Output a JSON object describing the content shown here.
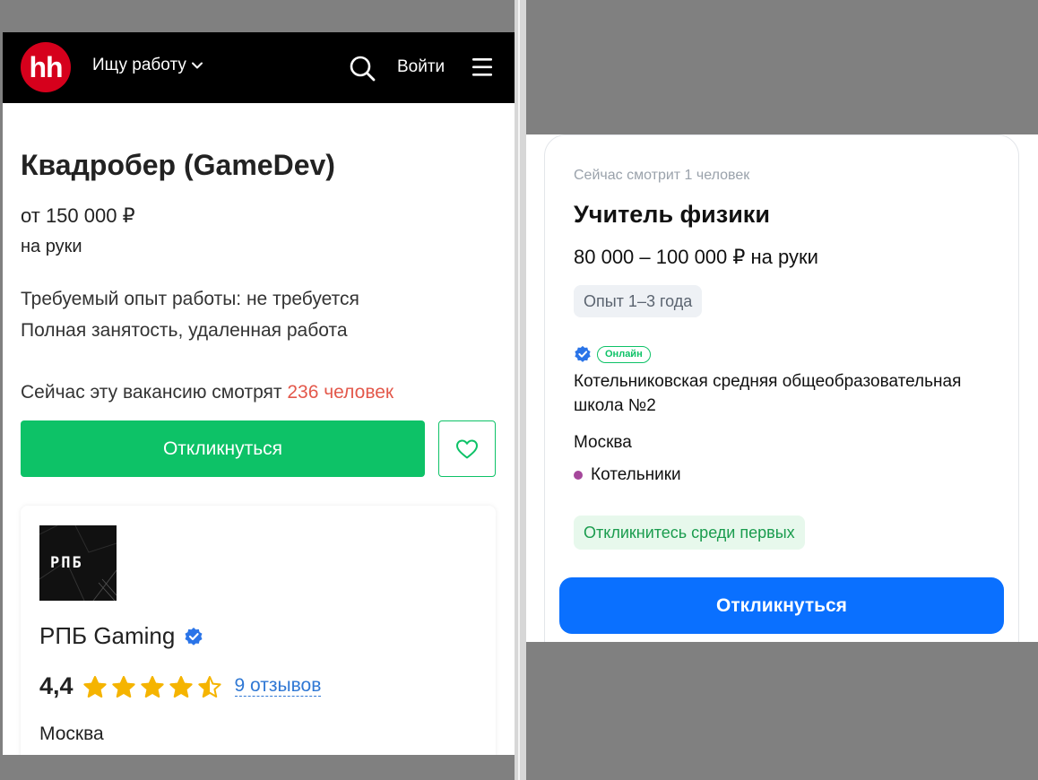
{
  "left_panel": {
    "header": {
      "logo_text": "hh",
      "mode_label": "Ищу работу",
      "login_label": "Войти"
    },
    "vacancy": {
      "title": "Квадробер (GameDev)",
      "salary": "от 150 000 ₽",
      "salary_note": "на руки",
      "experience": "Требуемый опыт работы: не требуется",
      "employment": "Полная занятость, удаленная работа",
      "watching_prefix": "Сейчас эту вакансию смотрят ",
      "watching_count": "236 человек",
      "apply_label": "Откликнуться"
    },
    "company": {
      "logo_text": "РПБ",
      "name": "РПБ Gaming",
      "rating": "4,4",
      "rating_value": 4.4,
      "rating_max": 5,
      "reviews": "9 отзывов",
      "city": "Москва"
    }
  },
  "right_panel": {
    "viewers": "Сейчас смотрит 1 человек",
    "title": "Учитель физики",
    "salary": "80 000 – 100 000 ₽ на руки",
    "experience": "Опыт 1–3 года",
    "online_badge": "Онлайн",
    "employer": "Котельниковская средняя общеобразовательная школа №2",
    "city": "Москва",
    "metro": "Котельники",
    "first_badge": "Откликнитесь среди первых",
    "apply_label": "Откликнуться"
  },
  "colors": {
    "hh_red": "#d6001c",
    "apply_green": "#0dc267",
    "watch_count_red": "#e3584b",
    "apply_blue": "#0a70ff",
    "verified_blue": "#2a74e8",
    "star_gold": "#f5b400",
    "metro_purple": "#a5479b"
  }
}
